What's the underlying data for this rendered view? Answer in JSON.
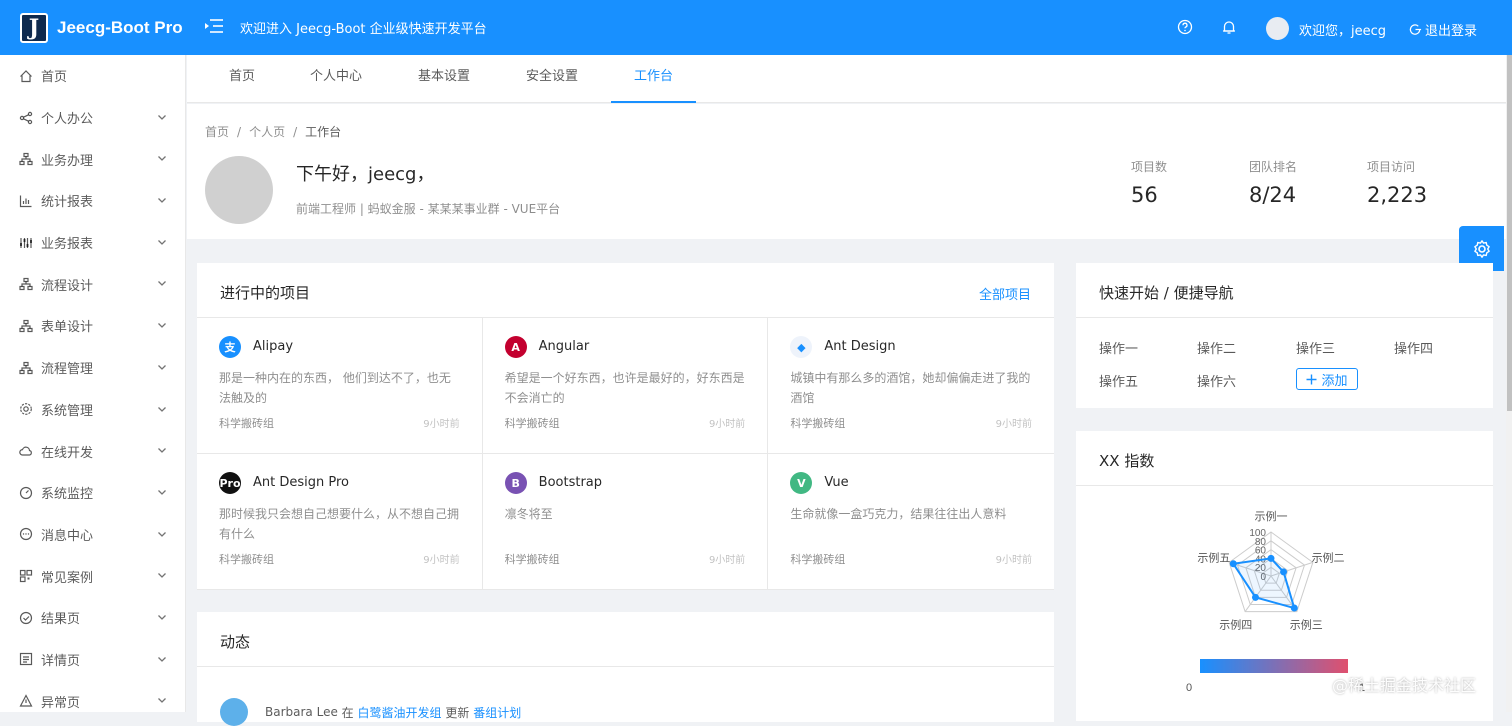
{
  "header": {
    "logo_letter": "J",
    "app_name": "Jeecg-Boot Pro",
    "welcome": "欢迎进入 Jeecg-Boot 企业级快速开发平台",
    "user_greeting": "欢迎您，jeecg",
    "logout": "退出登录",
    "icons": [
      "menu-fold-icon",
      "question-icon",
      "bell-icon",
      "logout-icon"
    ]
  },
  "sidebar": {
    "items": [
      {
        "label": "首页",
        "icon": "home-icon",
        "chevron": false
      },
      {
        "label": "个人办公",
        "icon": "share-icon",
        "chevron": true
      },
      {
        "label": "业务办理",
        "icon": "cluster-icon",
        "chevron": true
      },
      {
        "label": "统计报表",
        "icon": "bar-chart-icon",
        "chevron": true
      },
      {
        "label": "业务报表",
        "icon": "sliders-icon",
        "chevron": true
      },
      {
        "label": "流程设计",
        "icon": "cluster-icon",
        "chevron": true
      },
      {
        "label": "表单设计",
        "icon": "cluster-icon",
        "chevron": true
      },
      {
        "label": "流程管理",
        "icon": "cluster-icon",
        "chevron": true
      },
      {
        "label": "系统管理",
        "icon": "setting-icon",
        "chevron": true
      },
      {
        "label": "在线开发",
        "icon": "cloud-icon",
        "chevron": true
      },
      {
        "label": "系统监控",
        "icon": "dashboard-icon",
        "chevron": true
      },
      {
        "label": "消息中心",
        "icon": "message-icon",
        "chevron": true
      },
      {
        "label": "常见案例",
        "icon": "qrcode-icon",
        "chevron": true
      },
      {
        "label": "结果页",
        "icon": "check-circle-icon",
        "chevron": true
      },
      {
        "label": "详情页",
        "icon": "profile-icon",
        "chevron": true
      },
      {
        "label": "异常页",
        "icon": "warning-icon",
        "chevron": true
      }
    ]
  },
  "tabs": [
    {
      "label": "首页",
      "active": false
    },
    {
      "label": "个人中心",
      "active": false
    },
    {
      "label": "基本设置",
      "active": false
    },
    {
      "label": "安全设置",
      "active": false
    },
    {
      "label": "工作台",
      "active": true
    }
  ],
  "breadcrumb": [
    "首页",
    "个人页",
    "工作台"
  ],
  "profile": {
    "greeting": "下午好，jeecg，",
    "subtitle": "前端工程师 | 蚂蚁金服 - 某某某事业群 - VUE平台"
  },
  "stats": [
    {
      "label": "项目数",
      "value": "56"
    },
    {
      "label": "团队排名",
      "value": "8/24"
    },
    {
      "label": "项目访问",
      "value": "2,223"
    }
  ],
  "projects_card": {
    "title": "进行中的项目",
    "extra": "全部项目",
    "projects": [
      {
        "name": "Alipay",
        "desc": "那是一种内在的东西， 他们到达不了，也无法触及的",
        "group": "科学搬砖组",
        "time": "9小时前",
        "logo_text": "支",
        "color": "#1890ff"
      },
      {
        "name": "Angular",
        "desc": "希望是一个好东西，也许是最好的，好东西是不会消亡的",
        "group": "科学搬砖组",
        "time": "9小时前",
        "logo_text": "A",
        "color": "#c3002f"
      },
      {
        "name": "Ant Design",
        "desc": "城镇中有那么多的酒馆，她却偏偏走进了我的酒馆",
        "group": "科学搬砖组",
        "time": "9小时前",
        "logo_text": "◆",
        "color": "#eef3fb"
      },
      {
        "name": "Ant Design Pro",
        "desc": "那时候我只会想自己想要什么，从不想自己拥有什么",
        "group": "科学搬砖组",
        "time": "9小时前",
        "logo_text": "Pro",
        "color": "#111111"
      },
      {
        "name": "Bootstrap",
        "desc": "凛冬将至",
        "group": "科学搬砖组",
        "time": "9小时前",
        "logo_text": "B",
        "color": "#7952b3"
      },
      {
        "name": "Vue",
        "desc": "生命就像一盒巧克力，结果往往出人意料",
        "group": "科学搬砖组",
        "time": "9小时前",
        "logo_text": "V",
        "color": "#41b883"
      }
    ]
  },
  "activity_card": {
    "title": "动态",
    "row": {
      "user": "Barbara Lee",
      "word_in": "在",
      "group": "白鹭酱油开发组",
      "word_update": "更新",
      "target": "番组计划"
    }
  },
  "quick_nav": {
    "title": "快速开始 / 便捷导航",
    "ops": [
      "操作一",
      "操作二",
      "操作三",
      "操作四",
      "操作五",
      "操作六"
    ],
    "add": "添加"
  },
  "xx_card": {
    "title": "XX 指数"
  },
  "chart_data": {
    "type": "radar",
    "categories": [
      "示例一",
      "示例二",
      "示例三",
      "示例四",
      "示例五"
    ],
    "values": [
      40,
      30,
      90,
      60,
      90
    ],
    "rlim": [
      0,
      100
    ],
    "ticks": [
      "100",
      "80",
      "60",
      "40",
      "20",
      "0"
    ],
    "color": "#1890ff",
    "visual_map": {
      "min_label": "0",
      "max_label": "1",
      "colors": [
        "#1890ff",
        "#e0506e"
      ]
    }
  },
  "watermark": "@稀土掘金技术社区"
}
